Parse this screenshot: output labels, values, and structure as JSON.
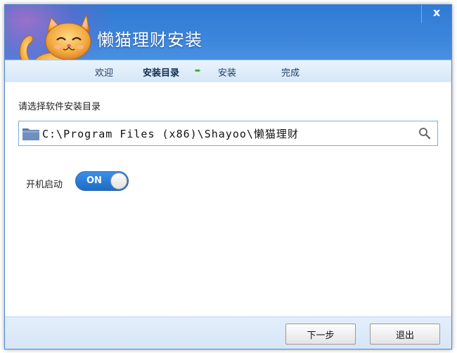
{
  "window": {
    "title": "懒猫理财安装",
    "close_label": "x"
  },
  "steps": [
    {
      "label": "欢迎",
      "active": false
    },
    {
      "label": "安装目录",
      "active": true
    },
    {
      "label": "安装",
      "active": false
    },
    {
      "label": "完成",
      "active": false
    }
  ],
  "step_arrow_icon": "green-right-arrow-icon",
  "install_dir": {
    "label": "请选择软件安装目录",
    "value": "C:\\Program Files (x86)\\Shayoo\\懒猫理财",
    "folder_icon": "folder-icon",
    "browse_icon": "search-icon"
  },
  "startup": {
    "label": "开机启动",
    "toggle_text": "ON",
    "enabled": true
  },
  "buttons": {
    "next": "下一步",
    "exit": "退出"
  },
  "colors": {
    "header_blue": "#3c86dc",
    "toggle_blue": "#2a7ad8",
    "input_border": "#7aaee0"
  }
}
